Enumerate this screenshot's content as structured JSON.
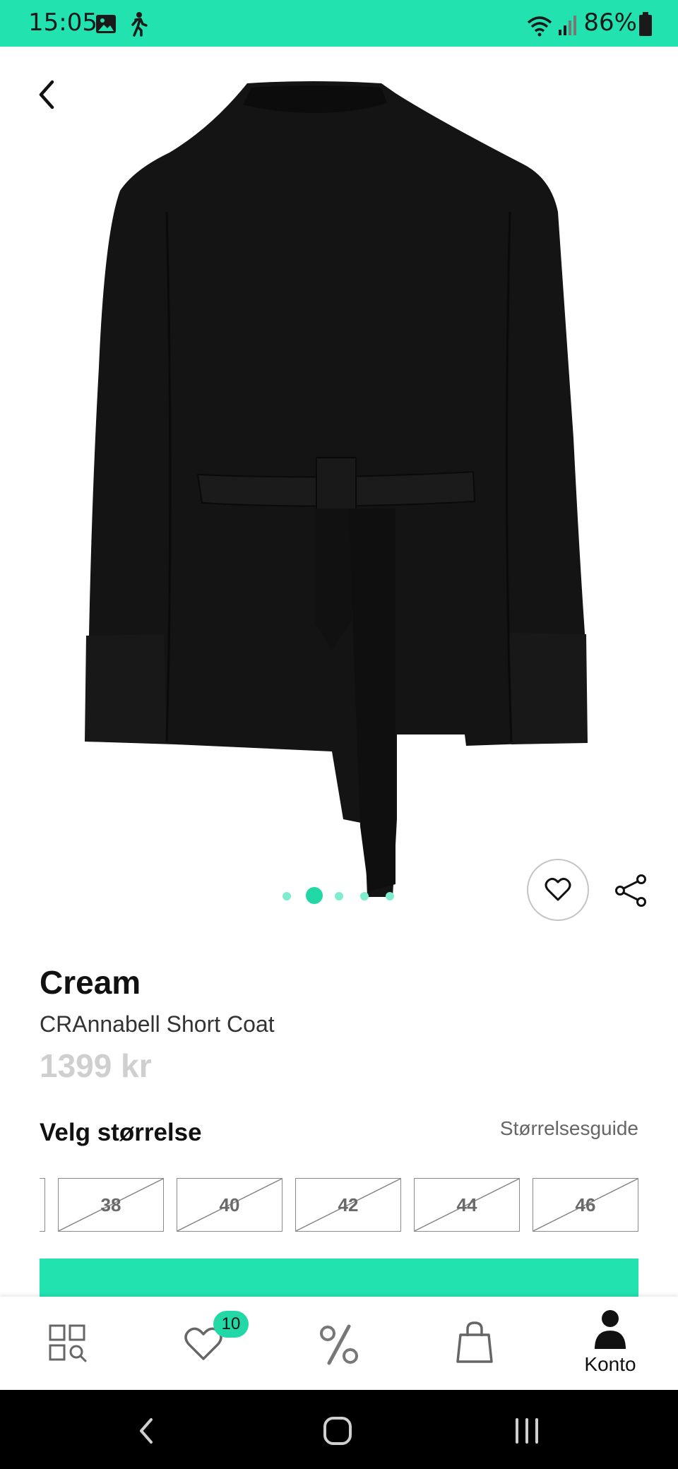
{
  "status_bar": {
    "time": "15:05",
    "battery": "86%",
    "icons": [
      "image-icon",
      "walking-icon",
      "wifi-icon",
      "signal-icon",
      "battery-icon"
    ],
    "background": "#22e3b0"
  },
  "product": {
    "brand": "Cream",
    "name": "CRAnnabell Short Coat",
    "price": "1399 kr",
    "image_icon": "black-coat-back-view",
    "carousel": {
      "count": 5,
      "active_index": 1
    }
  },
  "sizes": {
    "title": "Velg størrelse",
    "guide_link": "Størrelsesguide",
    "options": [
      {
        "label": "38",
        "available": false
      },
      {
        "label": "40",
        "available": false
      },
      {
        "label": "42",
        "available": false
      },
      {
        "label": "44",
        "available": false
      },
      {
        "label": "46",
        "available": false
      }
    ]
  },
  "bottom_nav": {
    "items": [
      {
        "icon": "categories-search-icon"
      },
      {
        "icon": "heart-icon",
        "badge": "10"
      },
      {
        "icon": "percent-icon"
      },
      {
        "icon": "shopping-bag-icon"
      },
      {
        "icon": "account-icon",
        "label": "Konto"
      }
    ]
  },
  "colors": {
    "accent": "#22e3b0",
    "accent_dark": "#22d8a6",
    "price_gray": "#cfcfcf"
  }
}
